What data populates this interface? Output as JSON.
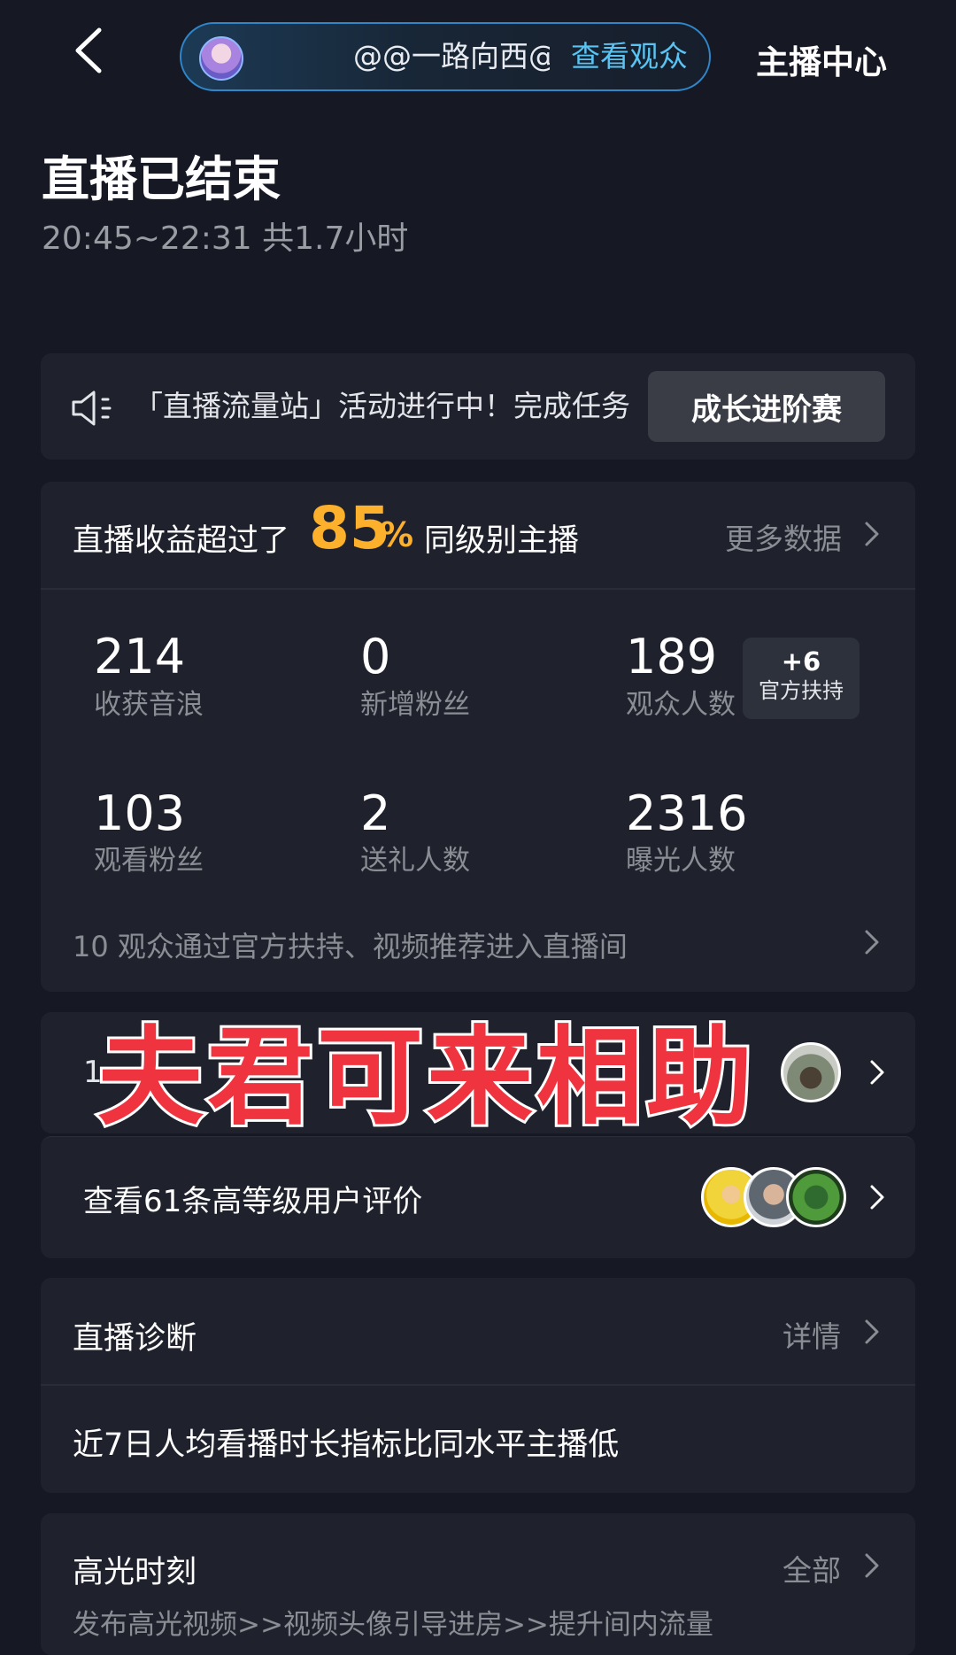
{
  "header": {
    "audience_user": "@@一路向西@",
    "view_audience": "查看观众",
    "host_center": "主播中心"
  },
  "title": "直播已结束",
  "time_range": "20:45~22:31 共1.7小时",
  "notice": {
    "text": "「直播流量站」活动进行中！完成任务",
    "button": "成长进阶赛"
  },
  "revenue": {
    "prefix": "直播收益超过了",
    "percent": "85",
    "percent_sign": "%",
    "suffix": "同级别主播",
    "more": "更多数据"
  },
  "stats": [
    {
      "value": "214",
      "label": "收获音浪"
    },
    {
      "value": "0",
      "label": "新增粉丝"
    },
    {
      "value": "189",
      "label": "观众人数"
    },
    {
      "value": "103",
      "label": "观看粉丝"
    },
    {
      "value": "2",
      "label": "送礼人数"
    },
    {
      "value": "2316",
      "label": "曝光人数"
    }
  ],
  "support_badge": {
    "value": "+6",
    "label": "官方扶持"
  },
  "stats_footer": "10 观众通过官方扶持、视频推荐进入直播间",
  "fans_row": {
    "prefix": "1"
  },
  "watermark": "夫君可来相助",
  "reviews": {
    "text": "查看61条高等级用户评价"
  },
  "diagnosis": {
    "title": "直播诊断",
    "detail": "详情",
    "text": "近7日人均看播时长指标比同水平主播低"
  },
  "highlights": {
    "title": "高光时刻",
    "all": "全部",
    "desc": "发布高光视频>>视频头像引导进房>>提升间内流量"
  },
  "icons": {
    "back": "chevron-left-icon",
    "speaker": "speaker-icon",
    "arrow": "chevron-right-icon"
  },
  "colors": {
    "background": "#161823",
    "card": "#1f222c",
    "accent_gold": "#fcb02c",
    "link_blue": "#59c3f2",
    "watermark_red": "#ef3440"
  }
}
